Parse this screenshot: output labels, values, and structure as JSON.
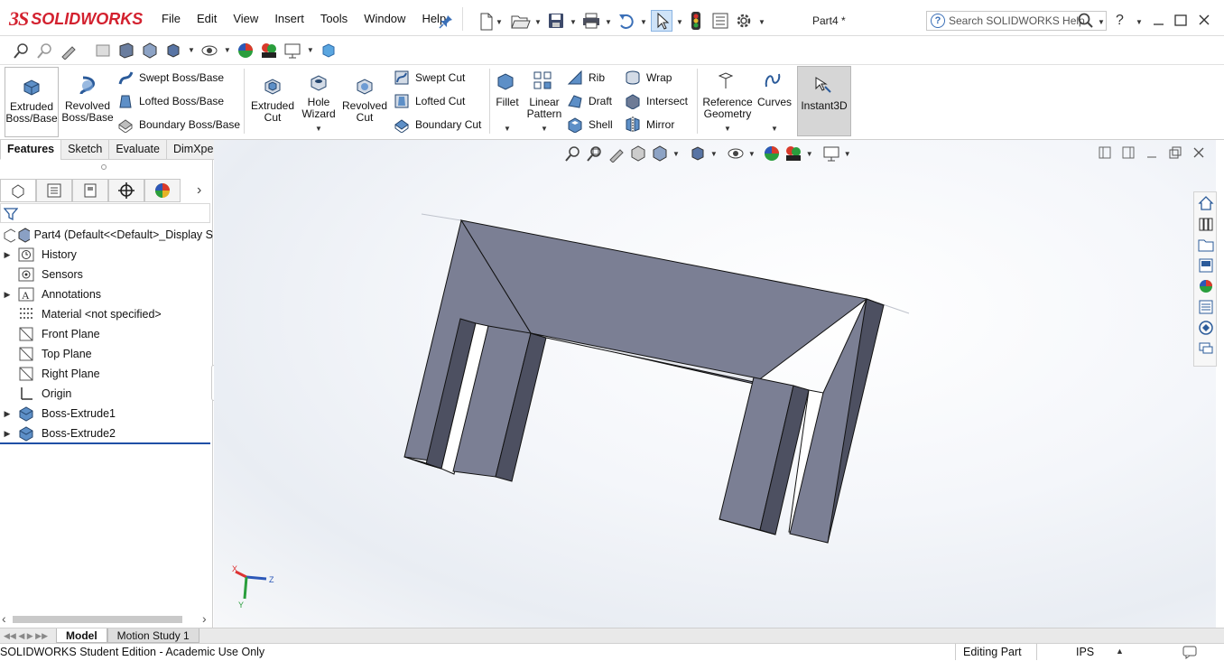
{
  "app": {
    "brand_ds": "3S",
    "brand_name": "SOLIDWORKS",
    "doc_title": "Part4 *"
  },
  "menu": {
    "items": [
      "File",
      "Edit",
      "View",
      "Insert",
      "Tools",
      "Window",
      "Help"
    ]
  },
  "search": {
    "placeholder": "Search SOLIDWORKS Help"
  },
  "command_manager": {
    "extruded_boss": "Extruded\nBoss/Base",
    "revolved_boss": "Revolved\nBoss/Base",
    "swept_boss": "Swept Boss/Base",
    "lofted_boss": "Lofted Boss/Base",
    "boundary_boss": "Boundary Boss/Base",
    "extruded_cut": "Extruded\nCut",
    "hole_wizard": "Hole\nWizard",
    "revolved_cut": "Revolved\nCut",
    "swept_cut": "Swept Cut",
    "lofted_cut": "Lofted Cut",
    "boundary_cut": "Boundary Cut",
    "fillet": "Fillet",
    "linear_pattern": "Linear\nPattern",
    "rib": "Rib",
    "draft": "Draft",
    "shell": "Shell",
    "wrap": "Wrap",
    "intersect": "Intersect",
    "mirror": "Mirror",
    "reference_geometry": "Reference\nGeometry",
    "curves": "Curves",
    "instant3d": "Instant3D"
  },
  "cmd_tabs": [
    "Features",
    "Sketch",
    "Evaluate",
    "DimXpert"
  ],
  "tree": {
    "root": "Part4  (Default<<Default>_Display S",
    "items": [
      {
        "label": "History",
        "expandable": true
      },
      {
        "label": "Sensors",
        "expandable": false
      },
      {
        "label": "Annotations",
        "expandable": true
      },
      {
        "label": "Material <not specified>",
        "expandable": false
      },
      {
        "label": "Front Plane",
        "expandable": false
      },
      {
        "label": "Top Plane",
        "expandable": false
      },
      {
        "label": "Right Plane",
        "expandable": false
      },
      {
        "label": "Origin",
        "expandable": false
      },
      {
        "label": "Boss-Extrude1",
        "expandable": true
      },
      {
        "label": "Boss-Extrude2",
        "expandable": true
      }
    ]
  },
  "triad": {
    "x": "X",
    "y": "Y",
    "z": "Z"
  },
  "bottom_tabs": [
    "Model",
    "Motion Study 1"
  ],
  "status": {
    "left": "SOLIDWORKS Student Edition - Academic Use Only",
    "mode": "Editing Part",
    "units": "IPS"
  },
  "colors": {
    "accent_red": "#d3212f",
    "part_face": "#7b7f94",
    "part_side": "#4d5061",
    "part_edge": "#111111",
    "selection_blue": "#1f4fa6"
  }
}
